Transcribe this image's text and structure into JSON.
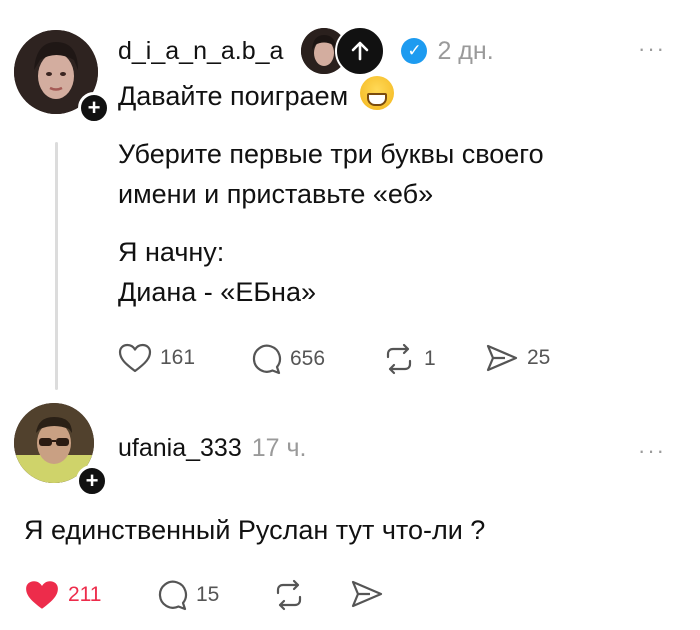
{
  "post": {
    "username": "d_i_a_n_a.b_a",
    "time": "2 дн.",
    "more": "···",
    "headline": "Давайте поиграем",
    "body_line1": "Уберите первые три буквы своего",
    "body_line2": "имени и приставьте «еб»",
    "body_line3": "Я начну:",
    "body_line4": "Диана - «ЕБна»",
    "likes": "161",
    "comments": "656",
    "reposts": "1",
    "shares": "25"
  },
  "reply": {
    "username": "ufania_333",
    "time": "17 ч.",
    "more": "···",
    "text": "Я единственный Руслан тут что-ли ?",
    "likes": "211",
    "comments": "15"
  },
  "colors": {
    "like_active": "#ed2c4b",
    "verified": "#1d9bf0",
    "muted": "#9a9a9a"
  },
  "icons": [
    "plus-icon",
    "up-arrow-icon",
    "verified-icon",
    "grinning-emoji-icon",
    "heart-icon",
    "comment-icon",
    "repost-icon",
    "share-icon"
  ]
}
